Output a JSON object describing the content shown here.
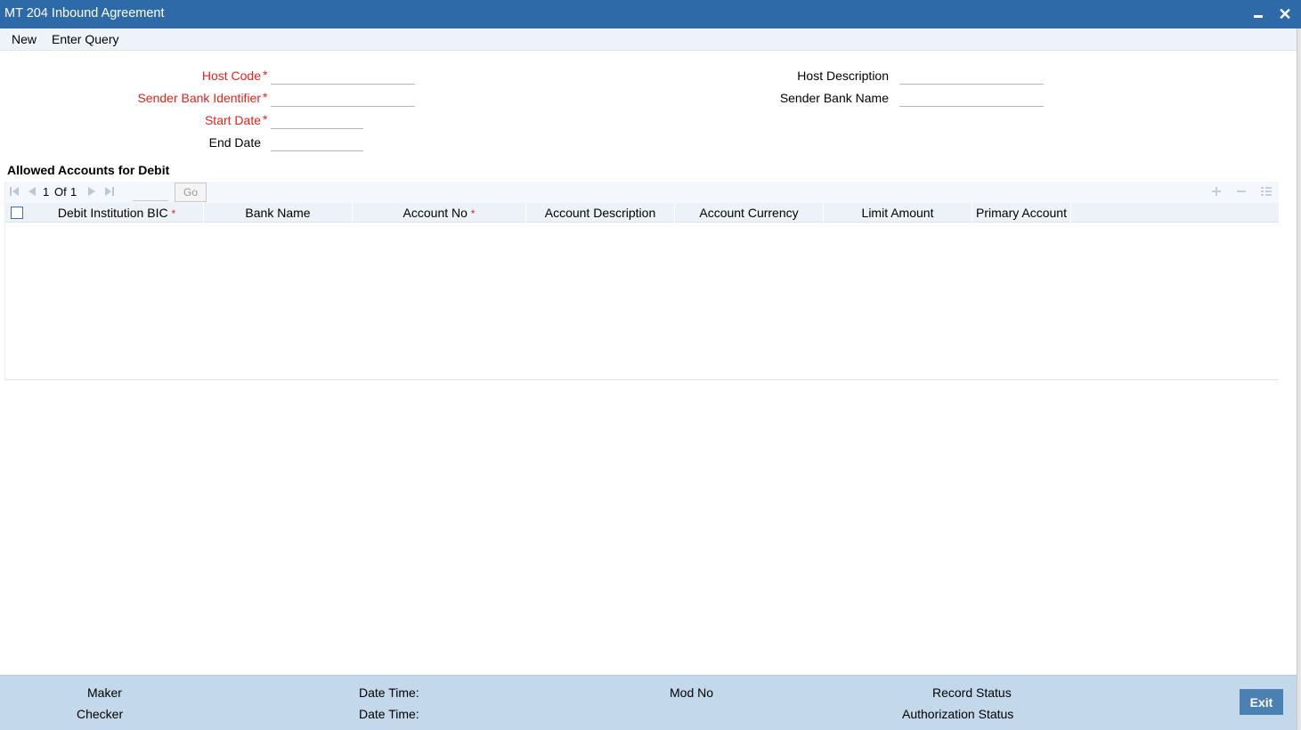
{
  "window": {
    "title": "MT 204 Inbound Agreement",
    "close_glyph": "✕"
  },
  "menu": {
    "new_label": "New",
    "enter_query_label": "Enter Query"
  },
  "form": {
    "host_code_label": "Host Code",
    "sender_bank_identifier_label": "Sender Bank Identifier",
    "start_date_label": "Start Date",
    "end_date_label": "End Date",
    "host_description_label": "Host Description",
    "sender_bank_name_label": "Sender Bank Name",
    "required_marker": "*",
    "host_code_value": "",
    "sender_bank_identifier_value": "",
    "start_date_value": "",
    "end_date_value": "",
    "host_description_value": "",
    "sender_bank_name_value": ""
  },
  "grid": {
    "section_title": "Allowed Accounts for Debit",
    "pager": {
      "current_page": "1",
      "of_label": "Of",
      "total_pages": "1",
      "go_label": "Go"
    },
    "columns": [
      {
        "label": "Debit Institution BIC",
        "required": "*"
      },
      {
        "label": "Bank Name",
        "required": ""
      },
      {
        "label": "Account No",
        "required": "*"
      },
      {
        "label": "Account Description",
        "required": ""
      },
      {
        "label": "Account Currency",
        "required": ""
      },
      {
        "label": "Limit Amount",
        "required": ""
      },
      {
        "label": "Primary Account",
        "required": ""
      }
    ],
    "rows": []
  },
  "footer": {
    "maker_label": "Maker",
    "checker_label": "Checker",
    "date_time_label_1": "Date Time:",
    "date_time_label_2": "Date Time:",
    "mod_no_label": "Mod No",
    "record_status_label": "Record Status",
    "authorization_status_label": "Authorization Status",
    "exit_label": "Exit"
  },
  "colors": {
    "titlebar": "#2f6aa8",
    "required_red": "#e2231a",
    "footer_bg": "#c3d8ea",
    "exit_button": "#4a80b2"
  }
}
